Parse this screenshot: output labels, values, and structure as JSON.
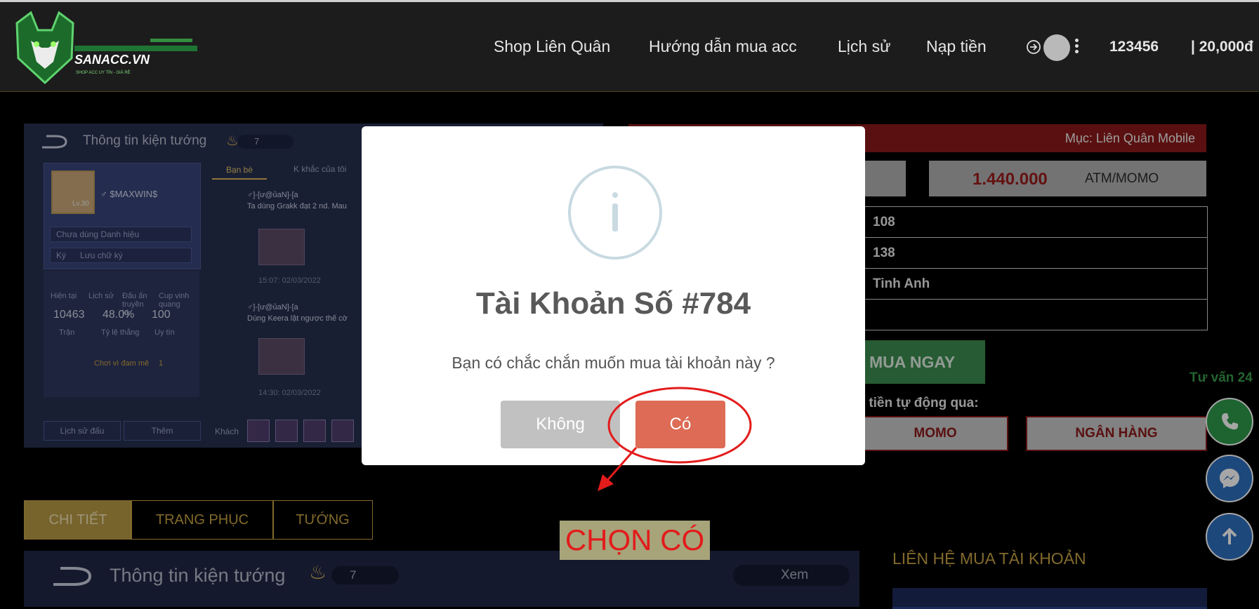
{
  "header": {
    "logo_text": "SANACC.VN",
    "logo_tagline": "SHOP ACC UY TÍN - GIÁ RẺ",
    "nav": [
      "Shop Liên Quân",
      "Hướng dẫn mua acc",
      "Lịch sử",
      "Nạp tiền"
    ],
    "username": "123456",
    "balance": "| 20,000đ"
  },
  "game_preview": {
    "title": "Thông tin kiện tướng",
    "count": "7",
    "player_name": "$MAXWIN$",
    "level": "Lv.30",
    "title_field": "Chưa dùng Danh hiệu",
    "sign_label": "Ký",
    "sign_field": "Lưu chữ ký",
    "tabs": [
      "Bạn bè",
      "K khắc của tôi"
    ],
    "badge_labels": [
      "Hiện tại",
      "Lịch sử",
      "Đấu ấn truyền kỳ",
      "Cup vinh quang"
    ],
    "stats": [
      {
        "value": "10463",
        "label": "Trận"
      },
      {
        "value": "48.0%",
        "label": "Tỷ lệ thắng"
      },
      {
        "value": "100",
        "label": "Uy tín"
      }
    ],
    "team_label": "Chơi vì đam mê",
    "team_count": "1",
    "posts": [
      {
        "author": "♂]-[ư@ủaN]-[a",
        "text": "Ta dùng Grakk đạt 2 nd. Mau",
        "time": "15:07: 02/03/2022"
      },
      {
        "author": "♂]-[ư@ủaN]-[a",
        "text": "Dùng Keera lật ngược thế cờ",
        "time": "14:30: 02/03/2022"
      }
    ],
    "bottom_buttons": [
      "Lịch sử đấu",
      "Thêm"
    ],
    "guest_label": "Khách"
  },
  "account_panel": {
    "category": "Mục: Liên Quân Mobile",
    "price": "1.440.000",
    "pay_method": "ATM/MOMO",
    "rows": [
      "108",
      "138",
      "Tinh Anh",
      ""
    ],
    "buy_label": "MUA NGAY",
    "auto_text": "tiền tự động qua:",
    "pay_buttons": [
      "MOMO",
      "NGÂN HÀNG"
    ],
    "consult_text": "Tư vấn 24"
  },
  "detail_tabs": [
    "CHI TIẾT",
    "TRANG PHỤC",
    "TƯỚNG"
  ],
  "game_preview2": {
    "title": "Thông tin kiện tướng",
    "count": "7",
    "view_label": "Xem"
  },
  "contact_heading": "LIÊN HỆ MUA TÀI KHOẢN",
  "modal": {
    "title": "Tài Khoản Số #784",
    "message": "Bạn có chắc chắn muốn mua tài khoản này ?",
    "cancel_label": "Không",
    "confirm_label": "Có"
  },
  "annotation": {
    "label": "CHỌN CÓ",
    "color": "#e31b1b"
  },
  "colors": {
    "accent_gold": "#c8a444",
    "confirm_red": "#dd6b55",
    "category_red": "#8a1a1a",
    "buy_green": "#3c8c4f"
  }
}
